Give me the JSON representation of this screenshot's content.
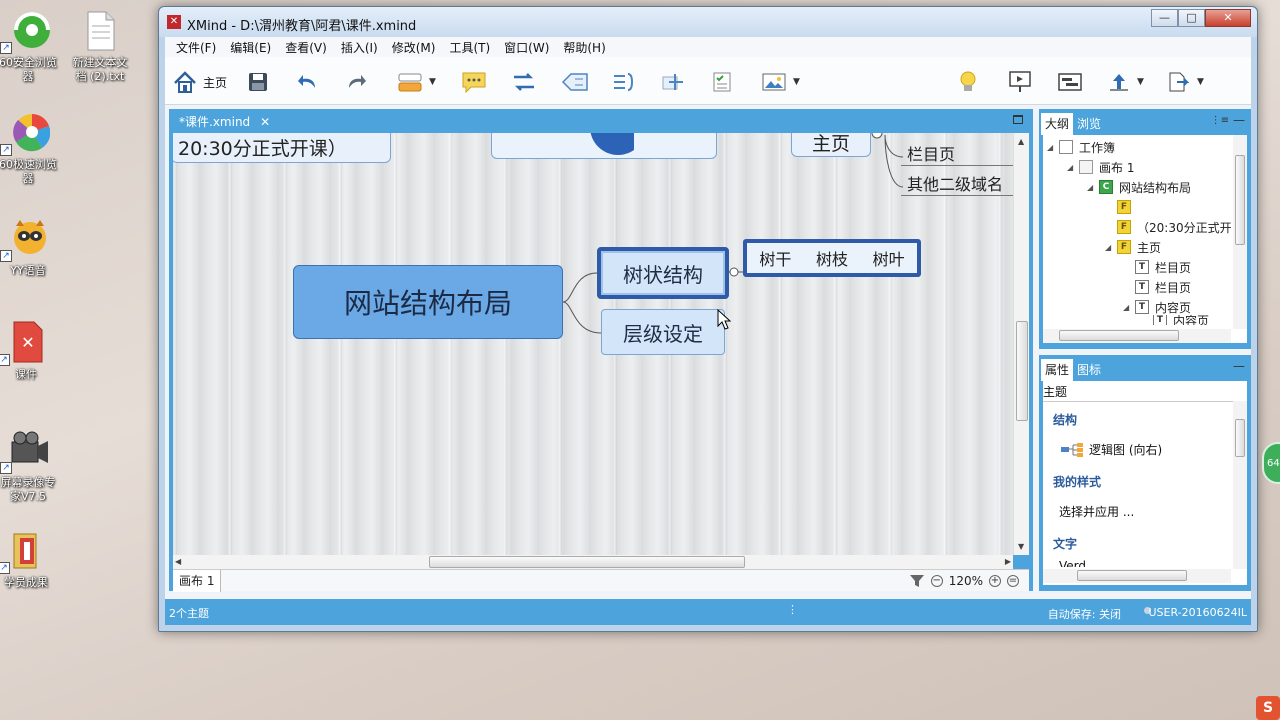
{
  "desktop": {
    "icons": [
      {
        "label": "60安全浏览\n器"
      },
      {
        "label": "新建文本文\n档 (2).txt"
      },
      {
        "label": "60极速浏览\n器"
      },
      {
        "label": "YY语音"
      },
      {
        "label": "课件"
      },
      {
        "label": "屏幕录像专\n家V7.5"
      },
      {
        "label": "学员成果"
      }
    ]
  },
  "window": {
    "title": "XMind - D:\\渭州教育\\阿君\\课件.xmind",
    "controls": {
      "minimize": "—",
      "maximize": "□",
      "close": "✕"
    }
  },
  "menu": [
    "文件(F)",
    "编辑(E)",
    "查看(V)",
    "插入(I)",
    "修改(M)",
    "工具(T)",
    "窗口(W)",
    "帮助(H)"
  ],
  "toolbar": {
    "home_label": "主页"
  },
  "editor": {
    "tab_label": "*课件.xmind",
    "tab_close": "✕",
    "sheet_label": "画布 1",
    "zoom": "120%"
  },
  "mindmap": {
    "central_topic": "网站结构布局",
    "subtopics": [
      "树状结构",
      "层级设定"
    ],
    "floating_items": [
      "树干",
      "树枝",
      "树叶"
    ],
    "partial_top": {
      "time_text": "20:30分正式开课）",
      "home_text": "主页",
      "list_items": [
        "栏目页",
        "其他二级域名"
      ]
    }
  },
  "outline_panel": {
    "tabs": [
      "大纲",
      "浏览"
    ],
    "tree": [
      {
        "label": "工作簿",
        "icon": "workbook",
        "level": 0
      },
      {
        "label": "画布 1",
        "icon": "sheet",
        "level": 1
      },
      {
        "label": "网站结构布局",
        "icon": "central",
        "level": 2
      },
      {
        "label": "",
        "icon": "floating",
        "level": 3
      },
      {
        "label": "（20:30分正式开",
        "icon": "floating",
        "level": 3
      },
      {
        "label": "主页",
        "icon": "floating",
        "level": 3
      },
      {
        "label": "栏目页",
        "icon": "topic",
        "level": 4
      },
      {
        "label": "栏目页",
        "icon": "topic",
        "level": 4
      },
      {
        "label": "内容页",
        "icon": "topic",
        "level": 4
      },
      {
        "label": "内容页",
        "icon": "topic",
        "level": 5
      }
    ]
  },
  "properties_panel": {
    "tabs": [
      "属性",
      "图标"
    ],
    "header": "主题",
    "structure_title": "结构",
    "structure_value": "逻辑图 (向右)",
    "my_styles_title": "我的样式",
    "my_styles_value": "选择并应用 ...",
    "text_title": "文字",
    "text_value": "Verd"
  },
  "status": {
    "topics_count": "2个主题",
    "autosave": "自动保存: 关闭",
    "user": "USER-20160624IL"
  }
}
